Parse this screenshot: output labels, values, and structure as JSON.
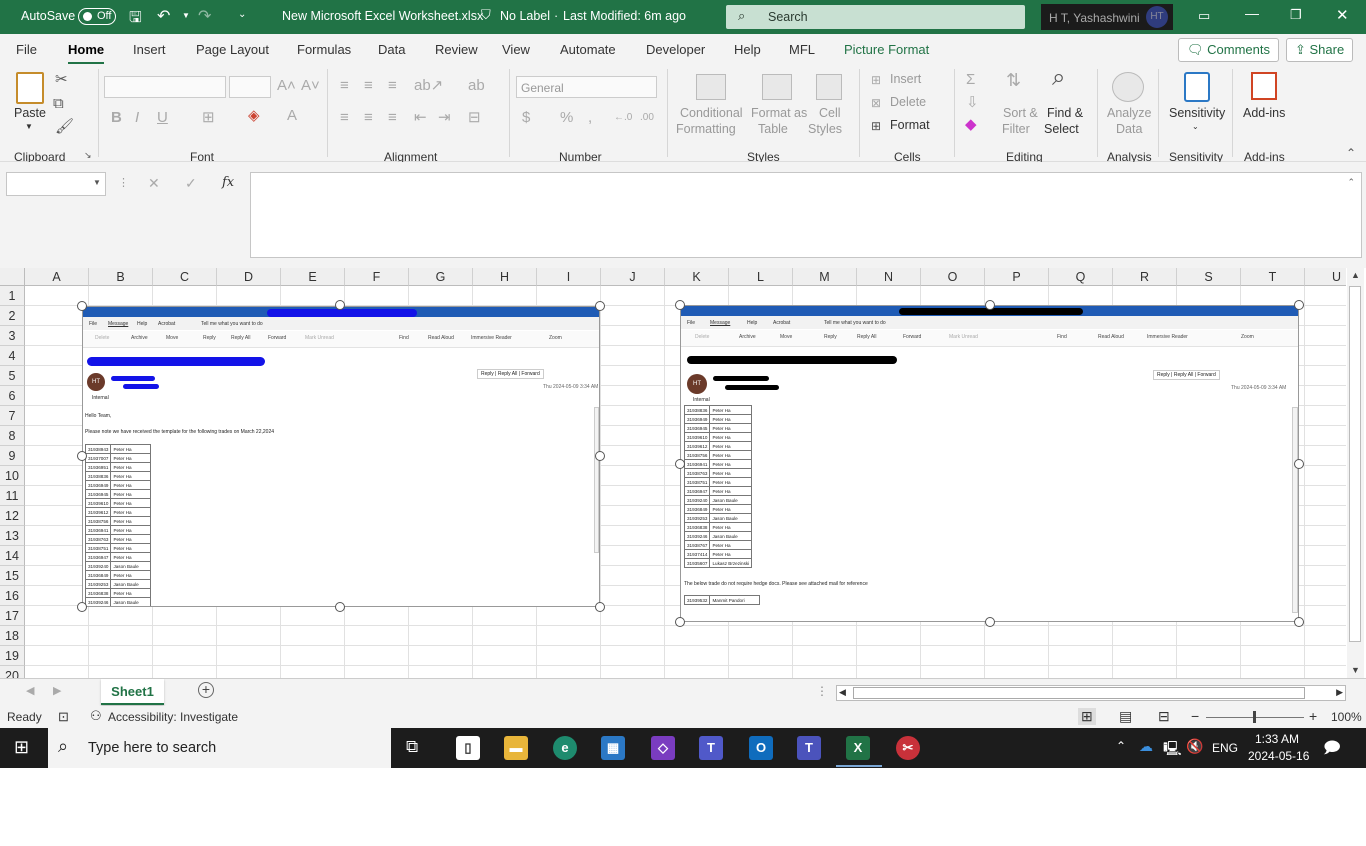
{
  "titlebar": {
    "autosave_label": "AutoSave",
    "autosave_state": "Off",
    "filename": "New Microsoft Excel Worksheet.xlsx",
    "label_status": "No Label",
    "last_modified": "Last Modified: 6m ago",
    "search_placeholder": "Search",
    "user_name": "H T, Yashashwini",
    "user_initials": "HT"
  },
  "menu": {
    "tabs": [
      "File",
      "Home",
      "Insert",
      "Page Layout",
      "Formulas",
      "Data",
      "Review",
      "View",
      "Automate",
      "Developer",
      "Help",
      "MFL",
      "Picture Format"
    ],
    "active": "Home",
    "comments_label": "Comments",
    "share_label": "Share"
  },
  "ribbon": {
    "clipboard": {
      "group": "Clipboard",
      "paste": "Paste"
    },
    "font": {
      "group": "Font",
      "bold": "B",
      "italic": "I",
      "underline": "U"
    },
    "alignment": {
      "group": "Alignment"
    },
    "number": {
      "group": "Number",
      "format": "General",
      "currency": "$",
      "percent": "%"
    },
    "styles": {
      "group": "Styles",
      "conditional": "Conditional",
      "conditional2": "Formatting",
      "format_as": "Format as",
      "format_as2": "Table",
      "cell": "Cell",
      "cell2": "Styles"
    },
    "cells": {
      "group": "Cells",
      "insert": "Insert",
      "delete": "Delete",
      "format": "Format"
    },
    "editing": {
      "group": "Editing",
      "sort": "Sort &",
      "sort2": "Filter",
      "find": "Find &",
      "find2": "Select"
    },
    "analysis": {
      "group": "Analysis",
      "analyze": "Analyze",
      "analyze2": "Data"
    },
    "sensitivity": {
      "group": "Sensitivity",
      "label": "Sensitivity"
    },
    "addins": {
      "group": "Add-ins",
      "label": "Add-ins"
    }
  },
  "formula_bar": {
    "fx": "fx",
    "cancel": "✕",
    "enter": "✓"
  },
  "grid": {
    "columns": [
      "A",
      "B",
      "C",
      "D",
      "E",
      "F",
      "G",
      "H",
      "I",
      "J",
      "K",
      "L",
      "M",
      "N",
      "O",
      "P",
      "Q",
      "R",
      "S",
      "T",
      "U"
    ],
    "rows": [
      "1",
      "2",
      "3",
      "4",
      "5",
      "6",
      "7",
      "8",
      "9",
      "10",
      "11",
      "12",
      "13",
      "14",
      "15",
      "16",
      "17",
      "18",
      "19",
      "20"
    ]
  },
  "picture1": {
    "tabs": [
      "File",
      "Message",
      "Help",
      "Acrobat",
      "Tell me what you want to do"
    ],
    "tools": [
      "Delete",
      "Archive",
      "Move",
      "Reply",
      "Reply All",
      "Forward",
      "Mark Unread",
      "Find",
      "Read Aloud",
      "Immersive Reader",
      "Zoom"
    ],
    "actions": [
      "Reply",
      "Reply All",
      "Forward"
    ],
    "initials": "HT",
    "internal": "Internal",
    "date": "Thu 2024-05-09 3:34 AM",
    "greeting": "Hello Team,",
    "body": "Please note we have received the template for the following trades on March 22,2024",
    "rows": [
      [
        "31938943",
        "Peter Ha"
      ],
      [
        "31937007",
        "Peter Ha"
      ],
      [
        "31936951",
        "Peter Ha"
      ],
      [
        "31938836",
        "Peter Ha"
      ],
      [
        "31936949",
        "Peter Ha"
      ],
      [
        "31936945",
        "Peter Ha"
      ],
      [
        "31939610",
        "Peter Ha"
      ],
      [
        "31939612",
        "Peter Ha"
      ],
      [
        "31938756",
        "Peter Ha"
      ],
      [
        "31936941",
        "Peter Ha"
      ],
      [
        "31938763",
        "Peter Ha"
      ],
      [
        "31938751",
        "Peter Ha"
      ],
      [
        "31936947",
        "Peter Ha"
      ],
      [
        "31939240",
        "Jason Baule"
      ],
      [
        "31936849",
        "Peter Ha"
      ],
      [
        "31939253",
        "Jason Baule"
      ],
      [
        "31936838",
        "Peter Ha"
      ],
      [
        "31939246",
        "Jason Baule"
      ]
    ]
  },
  "picture2": {
    "tabs": [
      "File",
      "Message",
      "Help",
      "Acrobat",
      "Tell me what you want to do"
    ],
    "tools": [
      "Delete",
      "Archive",
      "Move",
      "Reply",
      "Reply All",
      "Forward",
      "Mark Unread",
      "Find",
      "Read Aloud",
      "Immersive Reader",
      "Zoom"
    ],
    "actions": [
      "Reply",
      "Reply All",
      "Forward"
    ],
    "initials": "HT",
    "internal": "Internal",
    "date": "Thu 2024-05-09 3:34 AM",
    "rows": [
      [
        "31938836",
        "Peter Ha"
      ],
      [
        "31936949",
        "Peter Ha"
      ],
      [
        "31936945",
        "Peter Ha"
      ],
      [
        "31939610",
        "Peter Ha"
      ],
      [
        "31939612",
        "Peter Ha"
      ],
      [
        "31938756",
        "Peter Ha"
      ],
      [
        "31936941",
        "Peter Ha"
      ],
      [
        "31938763",
        "Peter Ha"
      ],
      [
        "31938751",
        "Peter Ha"
      ],
      [
        "31936947",
        "Peter Ha"
      ],
      [
        "31939240",
        "Jason Baule"
      ],
      [
        "31936849",
        "Peter Ha"
      ],
      [
        "31939253",
        "Jason Baule"
      ],
      [
        "31936838",
        "Peter Ha"
      ],
      [
        "31939246",
        "Jason Baule"
      ],
      [
        "31938767",
        "Peter Ha"
      ],
      [
        "31937414",
        "Peter Ha"
      ],
      [
        "31935607",
        "Lukasz Brzezinski"
      ]
    ],
    "note": "The below trade do not require hedge docs. Please see attached mail for reference",
    "extra_row": [
      "31939532",
      "Manmit Pandori"
    ]
  },
  "sheets": {
    "active": "Sheet1"
  },
  "status": {
    "ready": "Ready",
    "accessibility": "Accessibility: Investigate",
    "zoom": "100%"
  },
  "taskbar": {
    "search_placeholder": "Type here to search",
    "lang": "ENG",
    "time": "1:33 AM",
    "date": "2024-05-16"
  },
  "colors": {
    "excel_green": "#217346",
    "outlook_blue": "#1f5bb5"
  }
}
